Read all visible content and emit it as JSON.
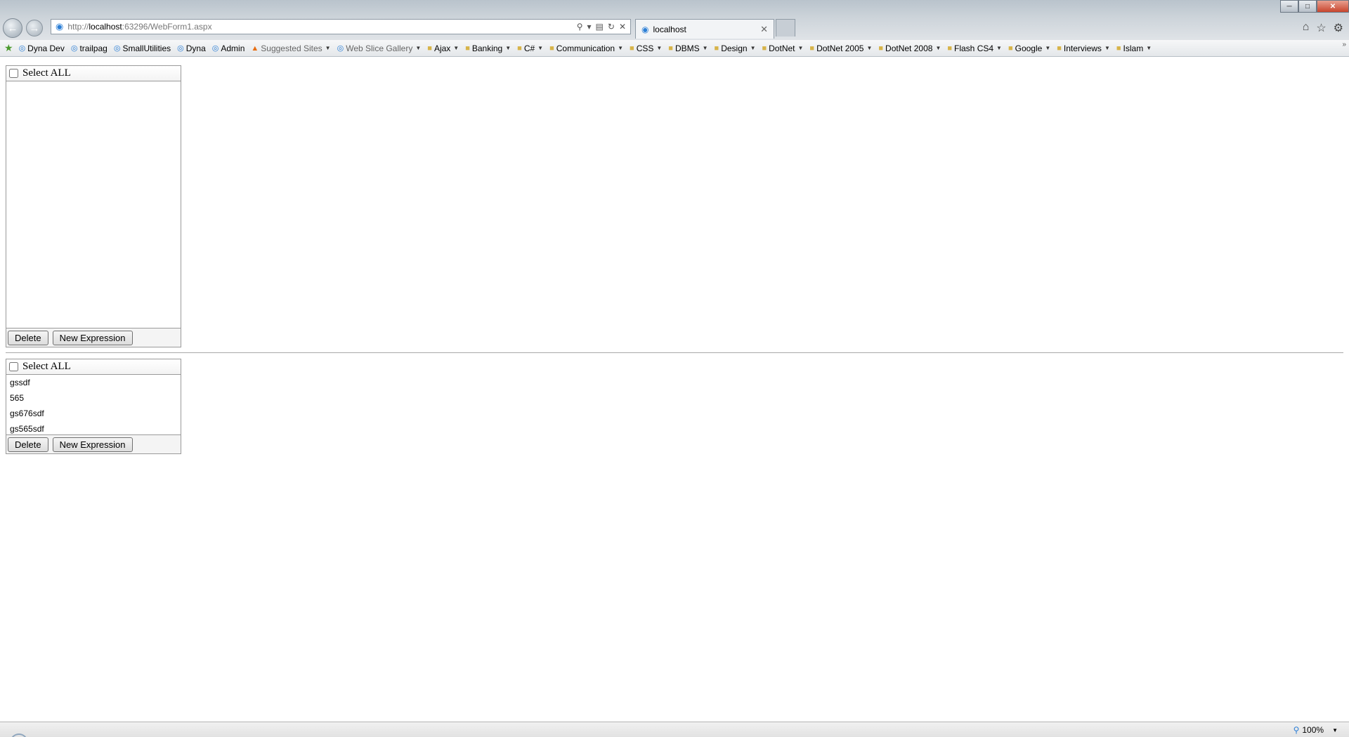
{
  "browser": {
    "address": {
      "prefix": "http://",
      "host": "localhost",
      "rest": ":63296/WebForm1.aspx"
    },
    "tab": {
      "title": "localhost"
    },
    "favorites": [
      {
        "label": "Dyna Dev",
        "icon": "page",
        "dropdown": false
      },
      {
        "label": "trailpag",
        "icon": "page",
        "dropdown": false
      },
      {
        "label": "SmallUtilities",
        "icon": "page",
        "dropdown": false
      },
      {
        "label": "Dyna",
        "icon": "page",
        "dropdown": false
      },
      {
        "label": "Admin",
        "icon": "page",
        "dropdown": false
      },
      {
        "label": "Suggested Sites",
        "icon": "suggest",
        "dropdown": true
      },
      {
        "label": "Web Slice Gallery",
        "icon": "page",
        "dropdown": true
      },
      {
        "label": "Ajax",
        "icon": "folder",
        "dropdown": true
      },
      {
        "label": "Banking",
        "icon": "folder",
        "dropdown": true
      },
      {
        "label": "C#",
        "icon": "folder",
        "dropdown": true
      },
      {
        "label": "Communication",
        "icon": "folder",
        "dropdown": true
      },
      {
        "label": "CSS",
        "icon": "folder",
        "dropdown": true
      },
      {
        "label": "DBMS",
        "icon": "folder",
        "dropdown": true
      },
      {
        "label": "Design",
        "icon": "folder",
        "dropdown": true
      },
      {
        "label": "DotNet",
        "icon": "folder",
        "dropdown": true
      },
      {
        "label": "DotNet 2005",
        "icon": "folder",
        "dropdown": true
      },
      {
        "label": "DotNet 2008",
        "icon": "folder",
        "dropdown": true
      },
      {
        "label": "Flash CS4",
        "icon": "folder",
        "dropdown": true
      },
      {
        "label": "Google",
        "icon": "folder",
        "dropdown": true
      },
      {
        "label": "Interviews",
        "icon": "folder",
        "dropdown": true
      },
      {
        "label": "Islam",
        "icon": "folder",
        "dropdown": true
      }
    ],
    "zoom": "100%"
  },
  "panel1": {
    "select_all_label": "Select ALL",
    "items": [],
    "delete_label": "Delete",
    "new_expression_label": "New Expression"
  },
  "panel2": {
    "select_all_label": "Select ALL",
    "items": [
      "gssdf",
      "565",
      "gs676sdf",
      "gs565sdf"
    ],
    "delete_label": "Delete",
    "new_expression_label": "New Expression"
  }
}
